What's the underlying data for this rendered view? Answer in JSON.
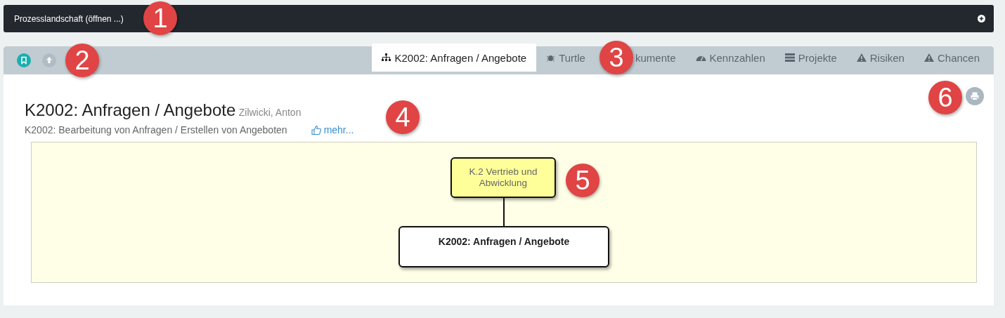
{
  "top_bar": {
    "title": "Prozesslandschaft (öffnen ...)"
  },
  "toolbar": {
    "tabs": [
      {
        "label": "K2002: Anfragen / Angebote",
        "kind": "sitemap",
        "selected": true
      },
      {
        "label": "Turtle",
        "kind": "bug",
        "selected": false
      },
      {
        "label": "kumente",
        "kind": "hidden",
        "selected": false
      },
      {
        "label": "Kennzahlen",
        "kind": "dashboard",
        "selected": false
      },
      {
        "label": "Projekte",
        "kind": "list",
        "selected": false
      },
      {
        "label": "Risiken",
        "kind": "warning",
        "selected": false
      },
      {
        "label": "Chancen",
        "kind": "warning",
        "selected": false
      }
    ]
  },
  "header": {
    "title": "K2002: Anfragen / Angebote",
    "owner": "Zilwicki, Anton",
    "description": "K2002: Bearbeitung von Anfragen / Erstellen von Angeboten",
    "more_link": "mehr..."
  },
  "diagram": {
    "parent": "K.2 Vertrieb und Abwicklung",
    "node": "K2002: Anfragen / Angebote"
  },
  "callouts": [
    "1",
    "2",
    "3",
    "4",
    "5",
    "6"
  ]
}
